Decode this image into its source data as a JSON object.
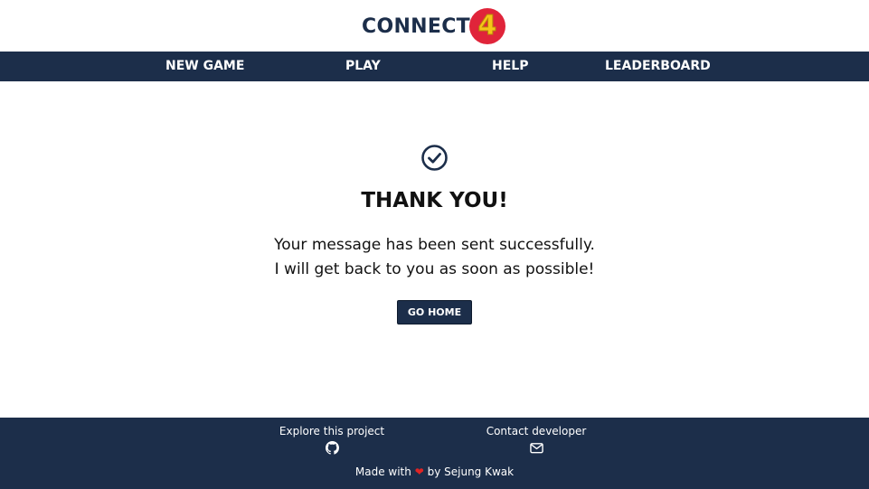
{
  "header": {
    "logo_text": "CONNECT",
    "logo_number": "4"
  },
  "nav": {
    "items": [
      {
        "label": "NEW GAME"
      },
      {
        "label": "PLAY"
      },
      {
        "label": "HELP"
      },
      {
        "label": "LEADERBOARD"
      }
    ]
  },
  "main": {
    "icon": "check-circle-icon",
    "title": "THANK YOU!",
    "message_line1": "Your message has been sent successfully.",
    "message_line2": "I will get back to you as soon as possible!",
    "button_label": "GO HOME"
  },
  "footer": {
    "explore_label": "Explore this project",
    "explore_icon": "github-icon",
    "contact_label": "Contact developer",
    "contact_icon": "envelope-icon",
    "made_with": "Made with",
    "heart": "❤",
    "by_text": "by Sejung Kwak"
  },
  "colors": {
    "navy": "#1c2e4a",
    "logo_badge_red": "#e0243a",
    "logo_number_yellow": "#f5c518",
    "heart_red": "#e02424"
  }
}
